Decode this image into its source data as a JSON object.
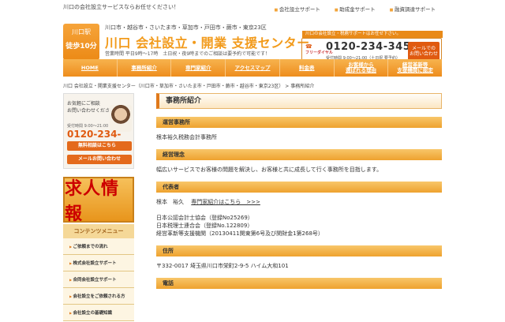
{
  "topbar": {
    "message": "川口の会社設立サービスならお任せください！",
    "links": [
      "会社設立サポート",
      "助成金サポート",
      "融資調達サポート"
    ]
  },
  "header": {
    "station_line1": "川口駅",
    "station_line2": "徒歩10分",
    "area": "川口市・越谷市・さいたま市・草加市・戸田市・蕨市・東京23区",
    "brand": "川口 会社設立・開業 支援センター",
    "hours": "営業時間 平日9時〜17時　土日祝・夜9時までのご相談は要予約で可能です！",
    "contact_note": "川口の会社設立・税務サポートはお任せ下さい。",
    "free_label": "フリーダイヤル",
    "tel": "0120-234-345",
    "contact_time": "受付時間 9:00〜21:00（土日祝 要予約）",
    "mail_label": "メールでの\nお問い合わせ"
  },
  "nav": [
    "HOME",
    "事務所紹介",
    "専門家紹介",
    "アクセスマップ",
    "料金表",
    "お客様から\n選ばれる理由",
    "経営革新等\n支援機関に認定"
  ],
  "breadcrumb": "川口 会社設立・開業支援センター（川口市・草加市・さいたま市・戸田市・蕨市・越谷市・東京23区） > 事務所紹介",
  "side": {
    "consult_text": "お気軽にご相談\nお問い合わせください",
    "hours": "受付時間 9:00〜21:00",
    "tel": "0120-234-345",
    "btn_free": "無料相談はこちら",
    "btn_mail": "メールお問い合わせ",
    "recruit": "求人情報",
    "menu_title": "コンテンツメニュー",
    "menu": [
      "ご依頼までの流れ",
      "株式会社設立サポート",
      "合同会社設立サポート",
      "会社設立をご依頼される方",
      "会社設立の基礎知識"
    ]
  },
  "main": {
    "title": "事務所紹介",
    "sections": [
      {
        "heading": "運営事務所",
        "text": "根本裕久税務会計事務所"
      },
      {
        "heading": "経営理念",
        "text": "幅広いサービスでお客様の問題を解決し、お客様と共に成長して行く事務所を目指します。"
      },
      {
        "heading": "代表者",
        "text": "根本　裕久",
        "link": "専門家紹介はこちら　>>>",
        "extra": [
          "日本公認会計士協会（登録No25269）",
          "日本税理士連合会（登録No.122809）",
          "経営革新等支援機関（20130411関東第6号及び関財金1第268号）"
        ]
      },
      {
        "heading": "住所",
        "text": "〒332-0017 埼玉県川口市栄町2-9-5 ハイム大和101"
      },
      {
        "heading": "電話",
        "text": ""
      }
    ]
  }
}
